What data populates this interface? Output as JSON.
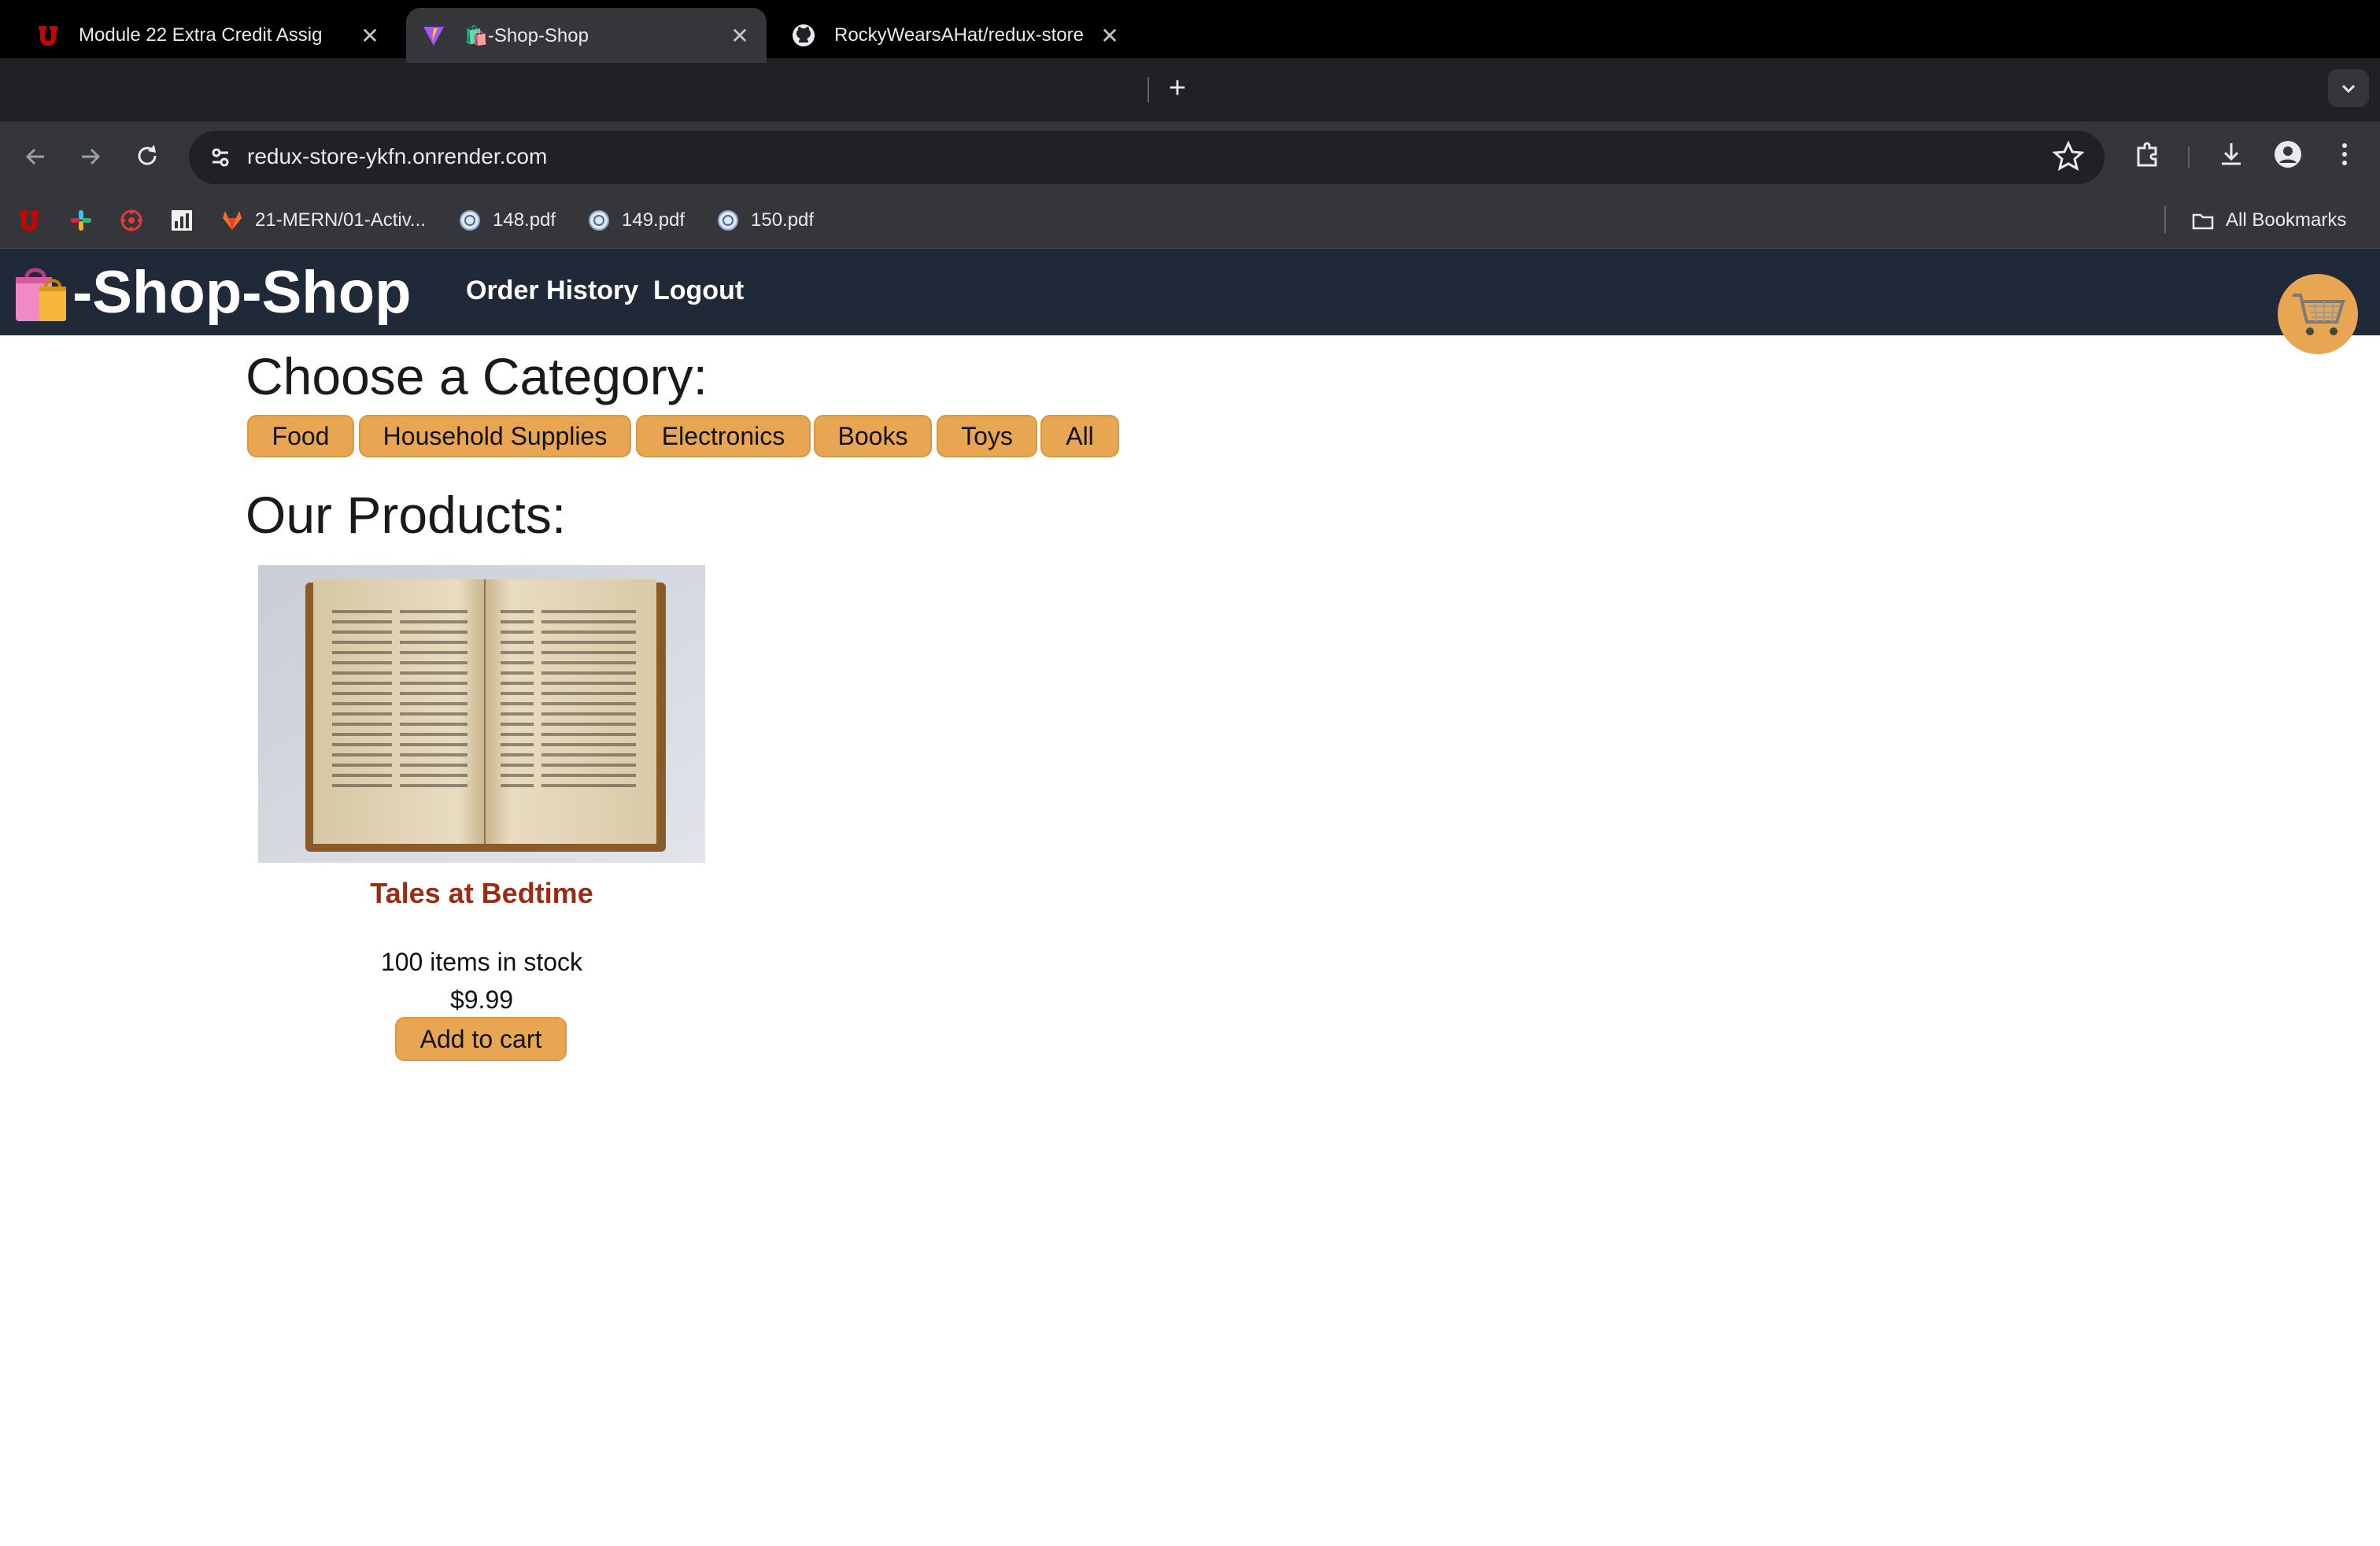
{
  "browser": {
    "tabs": [
      {
        "title": "Module 22 Extra Credit Assig",
        "icon": "utah-u-icon",
        "active": false
      },
      {
        "title": "🛍️-Shop-Shop",
        "icon": "vite-icon",
        "active": true
      },
      {
        "title": "RockyWearsAHat/redux-store",
        "icon": "github-icon",
        "active": false
      }
    ],
    "close_glyph": "✕",
    "new_tab_glyph": "+",
    "url": "redux-store-ykfn.onrender.com",
    "bookmarks": [
      {
        "label": "",
        "icon": "utah-u-icon"
      },
      {
        "label": "",
        "icon": "slack-icon"
      },
      {
        "label": "",
        "icon": "canvas-icon"
      },
      {
        "label": "",
        "icon": "chart-app-icon"
      },
      {
        "label": "21-MERN/01-Activ...",
        "icon": "gitlab-icon"
      },
      {
        "label": "148.pdf",
        "icon": "globe-icon"
      },
      {
        "label": "149.pdf",
        "icon": "globe-icon"
      },
      {
        "label": "150.pdf",
        "icon": "globe-icon"
      }
    ],
    "all_bookmarks": "All Bookmarks"
  },
  "app": {
    "brand": "-Shop-Shop",
    "nav": {
      "order_history": "Order History",
      "logout": "Logout"
    },
    "categories_heading": "Choose a Category:",
    "categories": [
      "Food",
      "Household Supplies",
      "Electronics",
      "Books",
      "Toys",
      "All"
    ],
    "products_heading": "Our Products:",
    "products": [
      {
        "name": "Tales at Bedtime",
        "stock": "100 items in stock",
        "price": "$9.99",
        "button": "Add to cart"
      }
    ]
  },
  "colors": {
    "header_bg": "#1f2937",
    "accent": "#e8a653",
    "product_name": "#9b2c14"
  }
}
